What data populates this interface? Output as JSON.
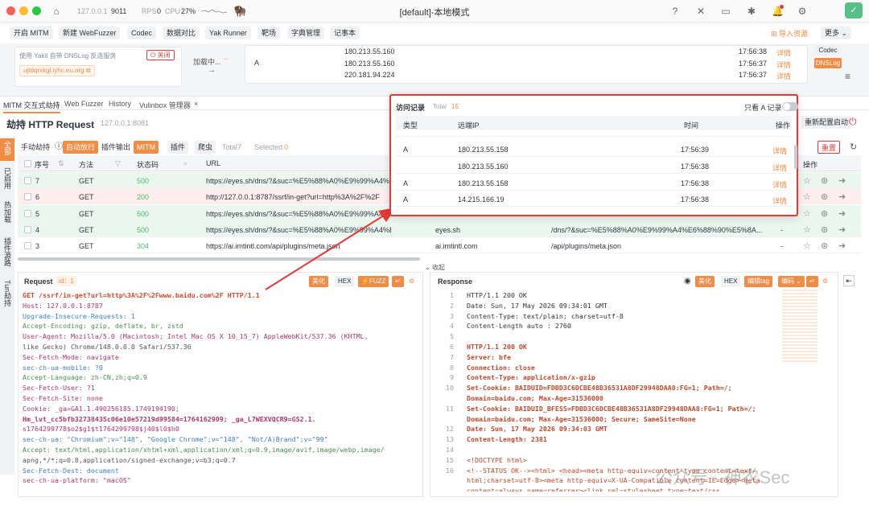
{
  "titlebar": {
    "host": "127.0.0.1",
    "port": "9011",
    "rps_label": "RPS",
    "rps_value": "0",
    "cpu_label": "CPU",
    "cpu_value": "27%",
    "title": "[default]-本地模式"
  },
  "toolbar": {
    "buttons": [
      "开启 MITM",
      "新建 WebFuzzer",
      "Codec",
      "数据对比",
      "Yak Runner",
      "靶场",
      "字典管理",
      "记事本"
    ],
    "import": "导入资源",
    "more": "更多"
  },
  "dnslog": {
    "desc": "使用 Yakit 自带 DNSLog 反连服务",
    "close_label": "关闭",
    "domain": "ujtdqrxkgl.iyhc.eu.org",
    "loading": "加载中...",
    "type": "A",
    "rows": [
      {
        "ip": "180.213.55.160",
        "time": "17:56:38",
        "action": "详情"
      },
      {
        "ip": "180.213.55.160",
        "time": "17:56:37",
        "action": "详情"
      },
      {
        "ip": "220.181.94.224",
        "time": "17:56:37",
        "action": "详情"
      }
    ],
    "side_codec": "Codec",
    "side_dnslog": "DNSLog"
  },
  "tabs": [
    "MITM 交互式劫持",
    "Web Fuzzer",
    "History",
    "Vulinbox 管理器"
  ],
  "page": {
    "title": "劫持 HTTP Request",
    "addr": "127.0.0.1:8081",
    "reconfig": "重新配置启动"
  },
  "sidebar": [
    "全部",
    "已启用",
    "热加载",
    "插件源路",
    "Tun劫持"
  ],
  "filters": {
    "manual": "手动劫持",
    "auto": "自动放行",
    "plugin_out": "插件输出",
    "mitm": "MITM",
    "plugin": "插件",
    "crawler": "爬虫",
    "total_label": "Total",
    "total": "7",
    "selected_label": "Selected",
    "selected": "0",
    "reset": "重置"
  },
  "table": {
    "headers": [
      "序号",
      "方法",
      "状态码",
      "URL",
      "操作"
    ],
    "rows": [
      {
        "id": "7",
        "method": "GET",
        "status": "500",
        "url": "https://eyes.sh/dns/?&suc=%E5%88%A0%E9%99%A4%",
        "host": "",
        "path": "",
        "dash": ""
      },
      {
        "id": "6",
        "method": "GET",
        "status": "200",
        "url": "http://127.0.0.1:8787/ssrf/in-get?url=http%3A%2F%2F",
        "host": "",
        "path": "",
        "dash": ""
      },
      {
        "id": "5",
        "method": "GET",
        "status": "500",
        "url": "https://eyes.sh/dns/?&suc=%E5%88%A0%E9%99%A4%",
        "host": "",
        "path": "",
        "dash": ""
      },
      {
        "id": "4",
        "method": "GET",
        "status": "500",
        "url": "https://eyes.sh/dns/?&suc=%E5%88%A0%E9%99%A4%E6%88...",
        "host": "eyes.sh",
        "path": "/dns/?&suc=%E5%88%A0%E9%99%A4%E6%88%90%E5%8A...",
        "dash": "-"
      },
      {
        "id": "3",
        "method": "GET",
        "status": "304",
        "url": "https://ai.imtintl.com/api/plugins/meta.json",
        "host": "ai.imtintl.com",
        "path": "/api/plugins/meta.json",
        "dash": "-"
      }
    ]
  },
  "collapse": "收起",
  "request": {
    "title": "Request",
    "id_label": "id：1",
    "beautify": "美化",
    "hex": "HEX",
    "fuzz": "FUZZ",
    "lines": [
      "GET /ssrf/in-get?url=http%3A%2F%2Fwww.baidu.com%2F HTTP/1.1",
      "Host: 127.0.0.1:8787",
      "Upgrade-Insecure-Requests: 1",
      "Accept-Encoding: gzip, deflate, br, zstd",
      "User-Agent: Mozilla/5.0 (Macintosh; Intel Mac OS X 10_15_7) AppleWebKit/537.36 (KHTML,",
      "like Gecko) Chrome/148.0.0.0 Safari/537.36",
      "Sec-Fetch-Mode: navigate",
      "sec-ch-ua-mobile: ?0",
      "Accept-Language: zh-CN,zh;q=0.9",
      "Sec-Fetch-User: ?1",
      "Sec-Fetch-Site: none",
      "Cookie: _ga=GA1.1.490256185.1749194190;",
      "Hm_lvt_cc5bfb32738435c06e10e57219d99584=1764162909; _ga_L7WEXVQCR9=GS2.1.",
      "s1764299778$o2$g1$t1764299798$j40$l0$h0",
      "sec-ch-ua: \"Chromium\";v=\"148\", \"Google Chrome\";v=\"148\", \"Not/A)Brand\";v=\"99\"",
      "Accept: text/html,application/xhtml+xml,application/xml;q=0.9,image/avif,image/webp,image/",
      "apng,*/*;q=0.8,application/signed-exchange;v=b3;q=0.7",
      "Sec-Fetch-Dest: document",
      "sec-ch-ua-platform: \"macOS\""
    ]
  },
  "response": {
    "title": "Response",
    "beautify": "美化",
    "hex": "HEX",
    "edit_tag": "编辑tag",
    "encode": "编码",
    "lines": [
      {
        "n": "1",
        "t": "HTTP/1.1 200 OK"
      },
      {
        "n": "2",
        "t": "Date: Sun, 17 May 2026 09:34:01 GMT"
      },
      {
        "n": "3",
        "t": "Content-Type: text/plain; charset=utf-8"
      },
      {
        "n": "4",
        "t": "Content-Length auto : 2760"
      },
      {
        "n": "5",
        "t": ""
      },
      {
        "n": "6",
        "t": "HTTP/1.1 200 OK"
      },
      {
        "n": "7",
        "t": "Server: bfe"
      },
      {
        "n": "8",
        "t": "Connection: close"
      },
      {
        "n": "9",
        "t": "Content-Type: application/x-gzip"
      },
      {
        "n": "10",
        "t": "Set-Cookie: BAIDUID=FDBD3C6DCBE48B36531A8DF29948DAA8:FG=1; Path=/;"
      },
      {
        "n": "",
        "t": "Domain=baidu.com; Max-Age=31536000"
      },
      {
        "n": "11",
        "t": "Set-Cookie: BAIDUID_BFESS=FDBD3C6DCBE48B36531A8DF29948DAA8:FG=1; Path=/;"
      },
      {
        "n": "",
        "t": "Domain=baidu.com; Max-Age=31536000; Secure; SameSite=None"
      },
      {
        "n": "12",
        "t": "Date: Sun, 17 May 2026 09:34:03 GMT"
      },
      {
        "n": "13",
        "t": "Content-Length: 2381"
      },
      {
        "n": "14",
        "t": ""
      },
      {
        "n": "15",
        "t": "<!DOCTYPE html>"
      },
      {
        "n": "16",
        "t": "<!--STATUS OK--><html> <head><meta http-equiv=content-type content=text/"
      },
      {
        "n": "",
        "t": "html;charset=utf-8><meta http-equiv=X-UA-Compatible content=IE=Edge><meta"
      },
      {
        "n": "",
        "t": "content=always name=referrer><link rel=stylesheet type=text/css"
      }
    ]
  },
  "popup": {
    "title": "访问记录",
    "total_label": "Total",
    "total": "15",
    "only_a": "只看 A 记录",
    "headers": [
      "类型",
      "远端IP",
      "时间",
      "操作"
    ],
    "rows": [
      {
        "type": "A",
        "ip": "180.213.55.158",
        "time": "17:56:39",
        "action": "详情"
      },
      {
        "type": "",
        "ip": "180.213.55.160",
        "time": "17:56:38",
        "action": "详情"
      },
      {
        "type": "A",
        "ip": "180.213.55.158",
        "time": "17:56:38",
        "action": "详情"
      },
      {
        "type": "A",
        "ip": "14.215.166.19",
        "time": "17:56:38",
        "action": "详情"
      }
    ]
  },
  "watermark": "公众号 · 神农Sec",
  "colors": {
    "accent": "#f28b44",
    "green": "#4fb874",
    "red": "#e53935"
  }
}
